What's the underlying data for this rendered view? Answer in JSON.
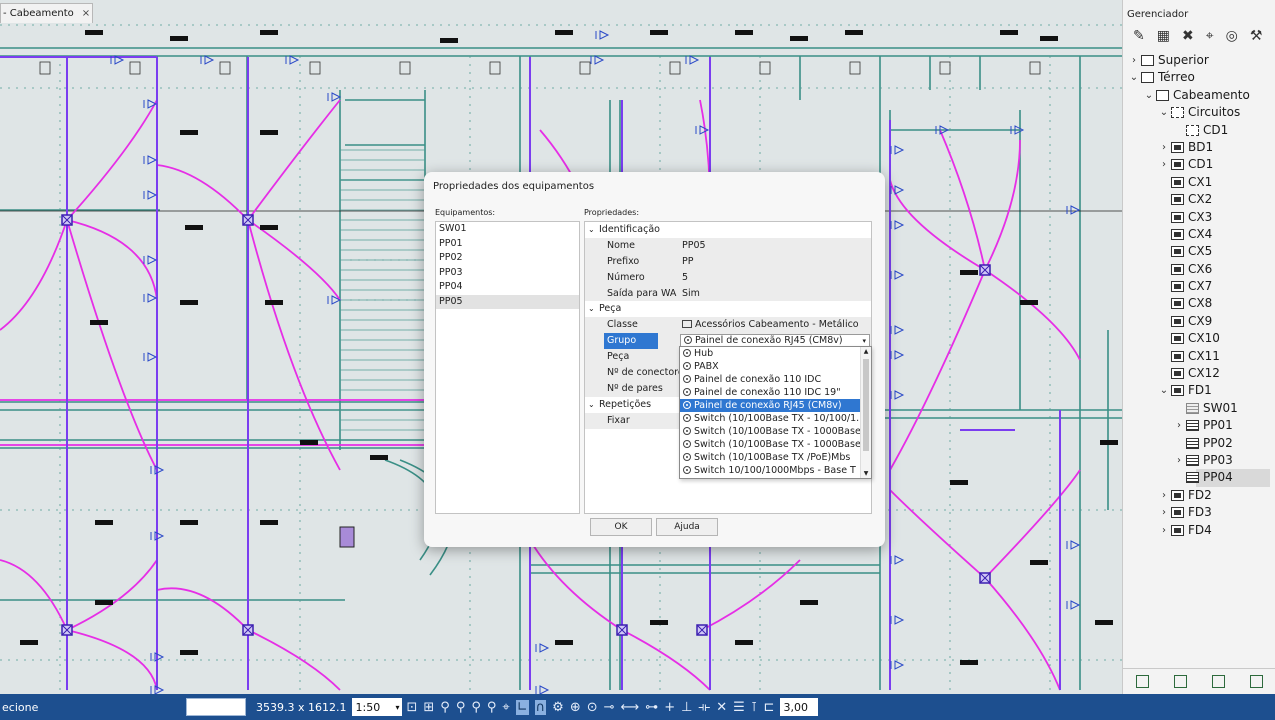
{
  "document_tab": {
    "label": "- Cabeamento",
    "close": "×"
  },
  "manager": {
    "title": "Gerenciador",
    "toolbar": [
      "✎",
      "▦",
      "✖",
      "⌖",
      "◎",
      "⚒"
    ],
    "tree": [
      {
        "label": "Superior",
        "chevron": "›",
        "icon": "floor",
        "level": 0
      },
      {
        "label": "Térreo",
        "chevron": "⌄",
        "icon": "floor",
        "level": 0
      },
      {
        "label": "Cabeamento",
        "chevron": "⌄",
        "icon": "cabling",
        "level": 1
      },
      {
        "label": "Circuitos",
        "chevron": "⌄",
        "icon": "circ",
        "level": 2
      },
      {
        "label": "CD1",
        "chevron": "",
        "icon": "circ",
        "level": 3
      },
      {
        "label": "BD1",
        "chevron": "›",
        "icon": "box",
        "level": 2
      },
      {
        "label": "CD1",
        "chevron": "›",
        "icon": "box",
        "level": 2
      },
      {
        "label": "CX1",
        "chevron": "",
        "icon": "box",
        "level": 2
      },
      {
        "label": "CX2",
        "chevron": "",
        "icon": "box",
        "level": 2
      },
      {
        "label": "CX3",
        "chevron": "",
        "icon": "box",
        "level": 2
      },
      {
        "label": "CX4",
        "chevron": "",
        "icon": "box",
        "level": 2
      },
      {
        "label": "CX5",
        "chevron": "",
        "icon": "box",
        "level": 2
      },
      {
        "label": "CX6",
        "chevron": "",
        "icon": "box",
        "level": 2
      },
      {
        "label": "CX7",
        "chevron": "",
        "icon": "box",
        "level": 2
      },
      {
        "label": "CX8",
        "chevron": "",
        "icon": "box",
        "level": 2
      },
      {
        "label": "CX9",
        "chevron": "",
        "icon": "box",
        "level": 2
      },
      {
        "label": "CX10",
        "chevron": "",
        "icon": "box",
        "level": 2
      },
      {
        "label": "CX11",
        "chevron": "",
        "icon": "box",
        "level": 2
      },
      {
        "label": "CX12",
        "chevron": "",
        "icon": "box",
        "level": 2
      },
      {
        "label": "FD1",
        "chevron": "⌄",
        "icon": "box",
        "level": 2
      },
      {
        "label": "SW01",
        "chevron": "",
        "icon": "sw",
        "level": 3
      },
      {
        "label": "PP01",
        "chevron": "›",
        "icon": "rack",
        "level": 3
      },
      {
        "label": "PP02",
        "chevron": "",
        "icon": "rack",
        "level": 3
      },
      {
        "label": "PP03",
        "chevron": "›",
        "icon": "rack",
        "level": 3
      },
      {
        "label": "PP04",
        "chevron": "",
        "icon": "rack",
        "level": 3,
        "selected": true
      },
      {
        "label": "FD2",
        "chevron": "›",
        "icon": "box",
        "level": 2
      },
      {
        "label": "FD3",
        "chevron": "›",
        "icon": "box",
        "level": 2
      },
      {
        "label": "FD4",
        "chevron": "›",
        "icon": "box",
        "level": 2
      }
    ]
  },
  "dialog": {
    "title": "Propriedades dos equipamentos",
    "equip_label": "Equipamentos:",
    "props_label": "Propriedades:",
    "equipment": [
      "SW01",
      "PP01",
      "PP02",
      "PP03",
      "PP04",
      "PP05"
    ],
    "selected_equipment": "PP05",
    "props": {
      "cat_ident": "Identificação",
      "nome_k": "Nome",
      "nome_v": "PP05",
      "prefixo_k": "Prefixo",
      "prefixo_v": "PP",
      "numero_k": "Número",
      "numero_v": "5",
      "saida_k": "Saída para WA",
      "saida_v": "Sim",
      "cat_peca": "Peça",
      "classe_k": "Classe",
      "classe_v": "Acessórios Cabeamento - Metálico",
      "grupo_k": "Grupo",
      "grupo_v": "Painel de conexão RJ45 (CM8v)",
      "peca_k": "Peça",
      "conectores_k": "Nº de conectores",
      "pares_k": "Nº de pares",
      "cat_rep": "Repetições",
      "fixar_k": "Fixar"
    },
    "group_options": [
      "Hub",
      "PABX",
      "Painel de conexão 110 IDC",
      "Painel de conexão 110 IDC 19\"",
      "Painel de conexão RJ45 (CM8v)",
      "Switch (10/100Base TX - 10/100/1...",
      "Switch (10/100Base TX - 1000Base...",
      "Switch (10/100Base TX - 1000Base...",
      "Switch (10/100Base TX /PoE)Mbs",
      "Switch 10/100/1000Mbps - Base T"
    ],
    "group_selected_index": 4,
    "ok": "OK",
    "help": "Ajuda"
  },
  "status": {
    "prompt": "ecione",
    "coords": "3539.3 x 1612.1",
    "scale": "1:50",
    "angle": "3,00",
    "tools": [
      "⊡",
      "⊞",
      "⚲",
      "⚲",
      "⚲",
      "⚲",
      "⌖",
      "∟",
      "∩",
      "⚙",
      "⊕",
      "⊙",
      "⊸",
      "⟷",
      "⊶",
      "+",
      "⊥",
      "⟛",
      "✕",
      "☰",
      "⊺",
      "⊏"
    ]
  }
}
